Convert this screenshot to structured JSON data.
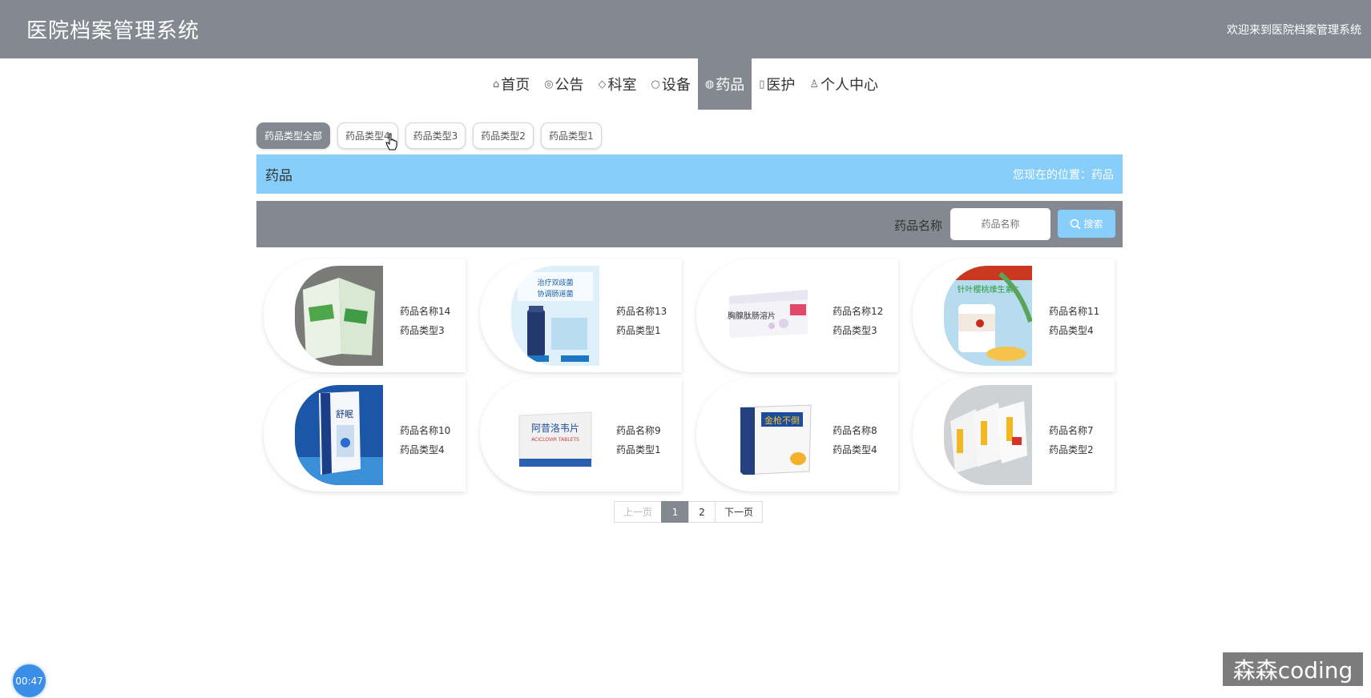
{
  "header": {
    "title": "医院档案管理系统",
    "welcome": "欢迎来到医院档案管理系统"
  },
  "nav": {
    "items": [
      {
        "label": "首页",
        "icon": "home-icon"
      },
      {
        "label": "公告",
        "icon": "announcement-icon"
      },
      {
        "label": "科室",
        "icon": "tag-icon"
      },
      {
        "label": "设备",
        "icon": "device-icon"
      },
      {
        "label": "药品",
        "icon": "medicine-icon",
        "active": true
      },
      {
        "label": "医护",
        "icon": "clipboard-icon"
      },
      {
        "label": "个人中心",
        "icon": "user-icon"
      }
    ]
  },
  "categories": [
    "药品类型全部",
    "药品类型4",
    "药品类型3",
    "药品类型2",
    "药品类型1"
  ],
  "banner": {
    "title": "药品",
    "location": "您现在的位置：药品"
  },
  "search": {
    "label": "药品名称",
    "placeholder": "药品名称",
    "button": "搜索"
  },
  "products": [
    {
      "name": "药品名称14",
      "type": "药品类型3"
    },
    {
      "name": "药品名称13",
      "type": "药品类型1"
    },
    {
      "name": "药品名称12",
      "type": "药品类型3"
    },
    {
      "name": "药品名称11",
      "type": "药品类型4"
    },
    {
      "name": "药品名称10",
      "type": "药品类型4"
    },
    {
      "name": "药品名称9",
      "type": "药品类型1"
    },
    {
      "name": "药品名称8",
      "type": "药品类型4"
    },
    {
      "name": "药品名称7",
      "type": "药品类型2"
    }
  ],
  "product_images": {
    "img13": [
      "治疗双歧菌",
      "协调肠道菌"
    ],
    "img12": [
      "胸腺肽肠溶片"
    ],
    "img11": [
      "针叶樱桃维生素C"
    ],
    "img10": [
      "舒眠"
    ],
    "img9": [
      "阿昔洛韦片",
      "ACICLOVIR TABLETS"
    ],
    "img8": [
      "金枪不倒"
    ]
  },
  "pagination": {
    "prev": "上一页",
    "pages": [
      "1",
      "2"
    ],
    "current": "1",
    "next": "下一页"
  },
  "timer": "00:47",
  "watermark": "森森coding"
}
